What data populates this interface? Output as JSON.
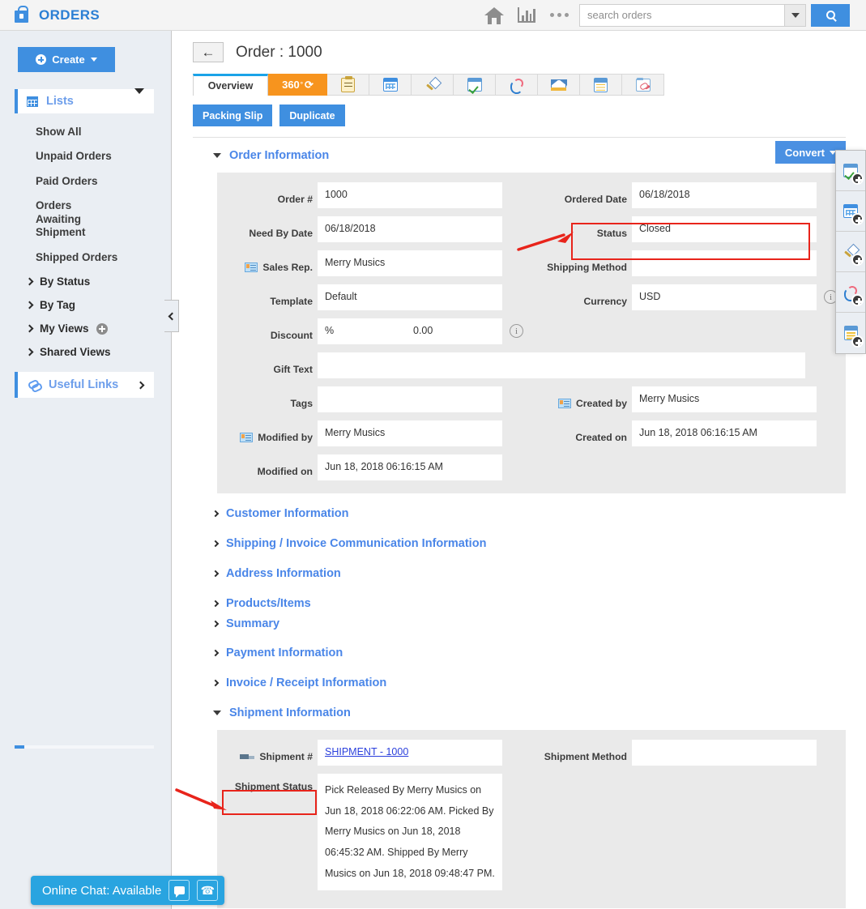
{
  "app": {
    "title": "ORDERS",
    "logo_icon": "shopping-bag-icon"
  },
  "topbar": {
    "home_icon": "home-icon",
    "reports_icon": "bar-chart-icon",
    "more_icon": "more-dots-icon",
    "search_placeholder": "search orders",
    "search_value": "",
    "search_dropdown_icon": "chevron-down-icon",
    "search_button_icon": "search-icon"
  },
  "sidebar": {
    "create_label": "Create",
    "lists_label": "Lists",
    "items": [
      {
        "label": "Show All"
      },
      {
        "label": "Unpaid Orders"
      },
      {
        "label": "Paid Orders"
      },
      {
        "label": "Orders Awaiting Shipment"
      },
      {
        "label": "Shipped Orders"
      }
    ],
    "groups": [
      {
        "label": "By Status",
        "has_add": false
      },
      {
        "label": "By Tag",
        "has_add": false
      },
      {
        "label": "My Views",
        "has_add": true
      },
      {
        "label": "Shared Views",
        "has_add": false
      }
    ],
    "useful_links_label": "Useful Links",
    "collapse_icon": "chevron-left-icon"
  },
  "page": {
    "back_icon": "back-arrow-icon",
    "title": "Order : 1000"
  },
  "tabs": [
    {
      "label": "Overview",
      "type": "text",
      "active": true
    },
    {
      "label": "360",
      "type": "360",
      "active": false
    },
    {
      "label": "",
      "type": "icon",
      "icon": "activity-clipboard-icon"
    },
    {
      "label": "",
      "type": "icon",
      "icon": "calendar-icon"
    },
    {
      "label": "",
      "type": "icon",
      "icon": "pin-icon"
    },
    {
      "label": "",
      "type": "icon",
      "icon": "task-check-icon"
    },
    {
      "label": "",
      "type": "icon",
      "icon": "call-icon"
    },
    {
      "label": "",
      "type": "icon",
      "icon": "email-icon"
    },
    {
      "label": "",
      "type": "icon",
      "icon": "notes-icon"
    },
    {
      "label": "",
      "type": "icon",
      "icon": "attachment-icon"
    }
  ],
  "actions": {
    "packing_slip": "Packing Slip",
    "duplicate": "Duplicate",
    "convert": "Convert"
  },
  "sections": [
    {
      "label": "Order Information",
      "expanded": true
    },
    {
      "label": "Customer Information",
      "expanded": false
    },
    {
      "label": "Shipping / Invoice Communication Information",
      "expanded": false
    },
    {
      "label": "Address Information",
      "expanded": false
    },
    {
      "label": "Products/Items",
      "expanded": false
    },
    {
      "label": "Summary",
      "expanded": false
    },
    {
      "label": "Payment Information",
      "expanded": false
    },
    {
      "label": "Invoice / Receipt Information",
      "expanded": false
    },
    {
      "label": "Shipment Information",
      "expanded": true
    }
  ],
  "order_information": {
    "order_number": {
      "label": "Order #",
      "value": "1000"
    },
    "ordered_date": {
      "label": "Ordered Date",
      "value": "06/18/2018"
    },
    "need_by_date": {
      "label": "Need By Date",
      "value": "06/18/2018"
    },
    "status": {
      "label": "Status",
      "value": "Closed",
      "highlighted": true
    },
    "sales_rep": {
      "label": "Sales Rep.",
      "value": "Merry Musics",
      "icon": "contact-card-icon"
    },
    "shipping_method": {
      "label": "Shipping Method",
      "value": ""
    },
    "template": {
      "label": "Template",
      "value": "Default"
    },
    "currency": {
      "label": "Currency",
      "value": "USD",
      "info_icon": "info-icon"
    },
    "discount": {
      "label": "Discount",
      "unit": "%",
      "value": "0.00",
      "info_icon": "info-icon"
    },
    "gift_text": {
      "label": "Gift Text",
      "value": ""
    },
    "tags": {
      "label": "Tags",
      "value": ""
    },
    "created_by": {
      "label": "Created by",
      "value": "Merry Musics",
      "icon": "contact-card-icon"
    },
    "modified_by": {
      "label": "Modified by",
      "value": "Merry Musics",
      "icon": "contact-card-icon"
    },
    "created_on": {
      "label": "Created on",
      "value": "Jun 18, 2018 06:16:15 AM"
    },
    "modified_on": {
      "label": "Modified on",
      "value": "Jun 18, 2018 06:16:15 AM"
    }
  },
  "shipment_information": {
    "shipment_number": {
      "label": "Shipment #",
      "value": "SHIPMENT - 1000",
      "icon": "truck-icon"
    },
    "shipment_method": {
      "label": "Shipment Method",
      "value": ""
    },
    "shipment_status": {
      "label": "Shipment Status",
      "highlighted": true,
      "value": "Pick Released By Merry Musics on Jun 18, 2018 06:22:06 AM. Picked By Merry Musics on Jun 18, 2018 06:45:32 AM. Shipped By Merry Musics on Jun 18, 2018 09:48:47 PM."
    }
  },
  "dock": [
    {
      "icon": "task-check-add-icon"
    },
    {
      "icon": "calendar-add-icon"
    },
    {
      "icon": "pin-add-icon"
    },
    {
      "icon": "call-add-icon"
    },
    {
      "icon": "note-add-icon"
    }
  ],
  "chat": {
    "label": "Online Chat: Available",
    "message_icon": "chat-bubble-icon",
    "call_icon": "phone-icon"
  },
  "colors": {
    "brand_blue": "#3f8fe0",
    "link_blue": "#4a86e8",
    "orange": "#f7941e",
    "highlight_red": "#e8241b",
    "panel_gray": "#eaeaea",
    "sidebar_bg": "#eaeef3"
  }
}
